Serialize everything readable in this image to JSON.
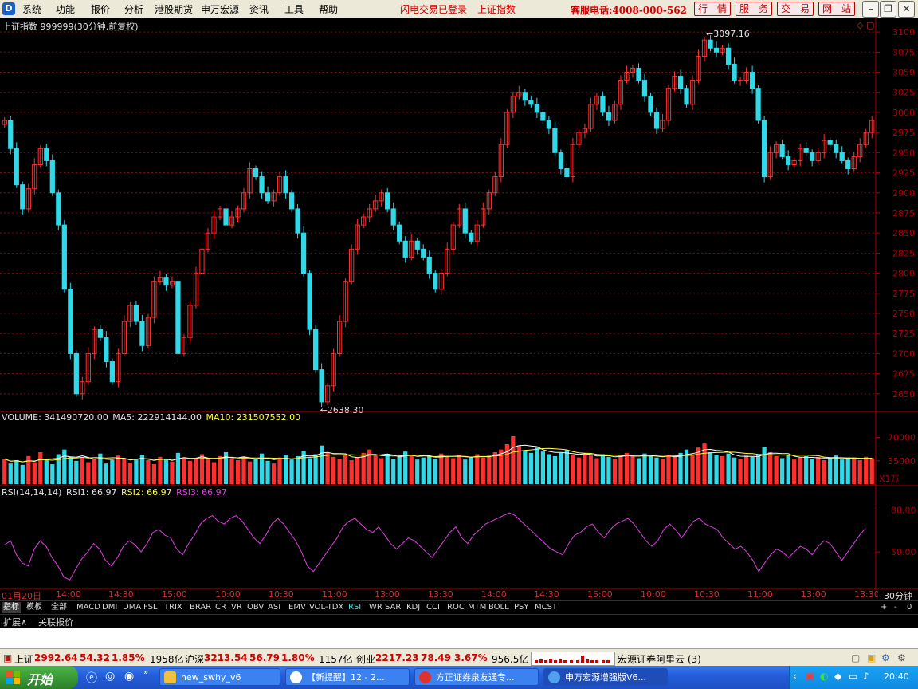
{
  "menubar": {
    "logo": "D",
    "items": [
      "系统",
      "功能",
      "报价",
      "分析",
      "港股期货",
      "申万宏源",
      "资讯",
      "工具",
      "帮助"
    ],
    "notice1": "闪电交易已登录",
    "notice2": "上证指数",
    "hotline": "客服电话:4008-000-562",
    "buttons": [
      "行　情",
      "服　务",
      "交　易",
      "网　站"
    ]
  },
  "chart": {
    "title": "上证指数 999999(30分钟.前复权)",
    "high_label": "3097.16",
    "low_label": "2638.30",
    "ylim": [
      2630,
      3112
    ],
    "yticks": [
      3100,
      3075,
      3050,
      3025,
      3000,
      2975,
      2950,
      2925,
      2900,
      2875,
      2850,
      2825,
      2800,
      2775,
      2750,
      2725,
      2700,
      2675,
      2650
    ],
    "close": [
      2990,
      2955,
      2910,
      2880,
      2905,
      2935,
      2955,
      2940,
      2900,
      2860,
      2780,
      2700,
      2650,
      2665,
      2700,
      2730,
      2720,
      2690,
      2665,
      2700,
      2740,
      2760,
      2740,
      2710,
      2745,
      2790,
      2795,
      2785,
      2790,
      2700,
      2720,
      2760,
      2800,
      2830,
      2850,
      2870,
      2880,
      2860,
      2870,
      2880,
      2900,
      2930,
      2920,
      2900,
      2890,
      2900,
      2920,
      2900,
      2880,
      2850,
      2800,
      2730,
      2680,
      2640,
      2660,
      2700,
      2740,
      2790,
      2830,
      2860,
      2870,
      2880,
      2890,
      2900,
      2880,
      2860,
      2840,
      2820,
      2840,
      2830,
      2820,
      2800,
      2780,
      2800,
      2830,
      2860,
      2880,
      2850,
      2840,
      2860,
      2880,
      2900,
      2920,
      2960,
      3000,
      3020,
      3025,
      3015,
      3010,
      3000,
      2990,
      2980,
      2950,
      2930,
      2920,
      2960,
      2975,
      2980,
      3010,
      3020,
      3000,
      2990,
      3010,
      3040,
      3050,
      3055,
      3040,
      3020,
      3000,
      2980,
      2990,
      3030,
      3045,
      3030,
      3010,
      3040,
      3070,
      3090,
      3080,
      3075,
      3080,
      3060,
      3040,
      3040,
      3050,
      3030,
      2990,
      2920,
      2950,
      2960,
      2945,
      2935,
      2940,
      2955,
      2950,
      2940,
      2950,
      2965,
      2960,
      2950,
      2940,
      2930,
      2945,
      2960,
      2975,
      2990
    ]
  },
  "volume": {
    "label": "VOLUME: 341490720.00",
    "ma5": "MA5: 222914144.00",
    "ma10": "MA10: 231507552.00",
    "ticks": [
      "70000",
      "35000"
    ],
    "unit": "X1万",
    "ylim": [
      0,
      90000
    ],
    "values": [
      38000,
      31000,
      36000,
      29000,
      42000,
      33000,
      48000,
      37000,
      30000,
      45000,
      52000,
      41000,
      35000,
      40000,
      33000,
      38000,
      46000,
      31000,
      36000,
      43000,
      39000,
      32000,
      37000,
      44000,
      36000,
      30000,
      41000,
      38000,
      34000,
      47000,
      40000,
      35000,
      39000,
      45000,
      37000,
      33000,
      42000,
      48000,
      39000,
      36000,
      41000,
      34000,
      38000,
      46000,
      35000,
      31000,
      40000,
      44000,
      37000,
      42000,
      50000,
      39000,
      45000,
      58000,
      47000,
      41000,
      38000,
      44000,
      36000,
      40000,
      47000,
      52000,
      43000,
      39000,
      45000,
      38000,
      41000,
      49000,
      44000,
      37000,
      40000,
      43000,
      38000,
      46000,
      42000,
      39000,
      44000,
      37000,
      41000,
      45000,
      40000,
      43000,
      48000,
      52000,
      60000,
      72000,
      58000,
      50000,
      47000,
      55000,
      49000,
      45000,
      42000,
      47000,
      51000,
      44000,
      40000,
      46000,
      43000,
      39000,
      45000,
      41000,
      38000,
      44000,
      47000,
      42000,
      39000,
      46000,
      43000,
      40000,
      38000,
      44000,
      41000,
      47000,
      52000,
      45000,
      55000,
      61000,
      48000,
      44000,
      42000,
      46000,
      40000,
      38000,
      43000,
      41000,
      45000,
      56000,
      48000,
      42000,
      39000,
      44000,
      37000,
      40000,
      42000,
      38000,
      41000,
      36000,
      39000,
      43000,
      37000,
      40000,
      38000,
      36000,
      41000,
      39000
    ]
  },
  "rsi": {
    "label": "RSI(14,14,14)",
    "rsi1": "RSI1: 66.97",
    "rsi2": "RSI2: 66.97",
    "rsi3": "RSI3: 66.97",
    "ticks": [
      "80.00",
      "50.00"
    ],
    "ylim": [
      25,
      90
    ],
    "values": [
      55,
      58,
      48,
      42,
      40,
      52,
      58,
      54,
      46,
      40,
      32,
      30,
      38,
      45,
      50,
      56,
      52,
      44,
      40,
      46,
      54,
      58,
      55,
      50,
      56,
      64,
      66,
      62,
      60,
      52,
      48,
      56,
      62,
      70,
      74,
      76,
      72,
      70,
      74,
      76,
      72,
      66,
      60,
      56,
      62,
      70,
      74,
      70,
      64,
      58,
      50,
      40,
      36,
      42,
      48,
      54,
      60,
      68,
      72,
      74,
      70,
      66,
      64,
      68,
      62,
      56,
      52,
      56,
      60,
      58,
      54,
      50,
      46,
      52,
      58,
      64,
      68,
      60,
      56,
      62,
      66,
      70,
      72,
      74,
      76,
      78,
      76,
      72,
      68,
      64,
      60,
      56,
      52,
      50,
      48,
      56,
      62,
      64,
      68,
      70,
      64,
      60,
      66,
      70,
      72,
      74,
      70,
      64,
      58,
      54,
      58,
      66,
      70,
      66,
      60,
      66,
      72,
      74,
      70,
      68,
      66,
      60,
      56,
      52,
      54,
      50,
      44,
      36,
      42,
      48,
      52,
      50,
      46,
      50,
      54,
      52,
      48,
      54,
      58,
      56,
      50,
      44,
      50,
      56,
      62,
      67
    ]
  },
  "xaxis": [
    "01月20日",
    "14:00",
    "14:30",
    "15:00",
    "10:00",
    "10:30",
    "11:00",
    "13:00",
    "13:30",
    "14:00",
    "14:30",
    "15:00",
    "10:00",
    "10:30",
    "11:00",
    "13:00",
    "13:30"
  ],
  "period_label": "30分钟",
  "tabs": [
    "指标",
    "模板",
    "全部",
    "MACD",
    "DMI",
    "DMA",
    "FSL",
    "TRIX",
    "BRAR",
    "CR",
    "VR",
    "OBV",
    "ASI",
    "EMV",
    "VOL-TDX",
    "RSI",
    "WR",
    "SAR",
    "KDJ",
    "CCI",
    "ROC",
    "MTM",
    "BOLL",
    "PSY",
    "MCST"
  ],
  "tab_controls": [
    "+",
    "-",
    "0"
  ],
  "tabs2": [
    "扩展∧",
    "关联报价"
  ],
  "status": {
    "sh_name": "上证",
    "sh_val": "2992.64",
    "sh_chg": "54.32",
    "sh_pct": "1.85%",
    "sh_amt": "1958亿",
    "hs_name": "沪深",
    "hs_val": "3213.54",
    "hs_chg": "56.79",
    "hs_pct": "1.80%",
    "hs_amt": "1157亿",
    "cy_name": "创业",
    "cy_val": "2217.23",
    "cy_chg": "78.49",
    "cy_pct": "3.67%",
    "cy_amt": "956.5亿",
    "server": "宏源证券阿里云 (3)"
  },
  "taskbar": {
    "start": "开始",
    "tasks": [
      "new_swhy_v6",
      "【新提醒】12 - 2...",
      "方正证券泉友通专...",
      "申万宏源增强版V6..."
    ],
    "time": "20:40"
  },
  "colors": {
    "up": "#ff3030",
    "down": "#30d8e8",
    "grid": "#801010",
    "axis": "#b00000",
    "rsi": "#e040e0",
    "ma5": "#ffffff",
    "ma10": "#ffff40"
  }
}
